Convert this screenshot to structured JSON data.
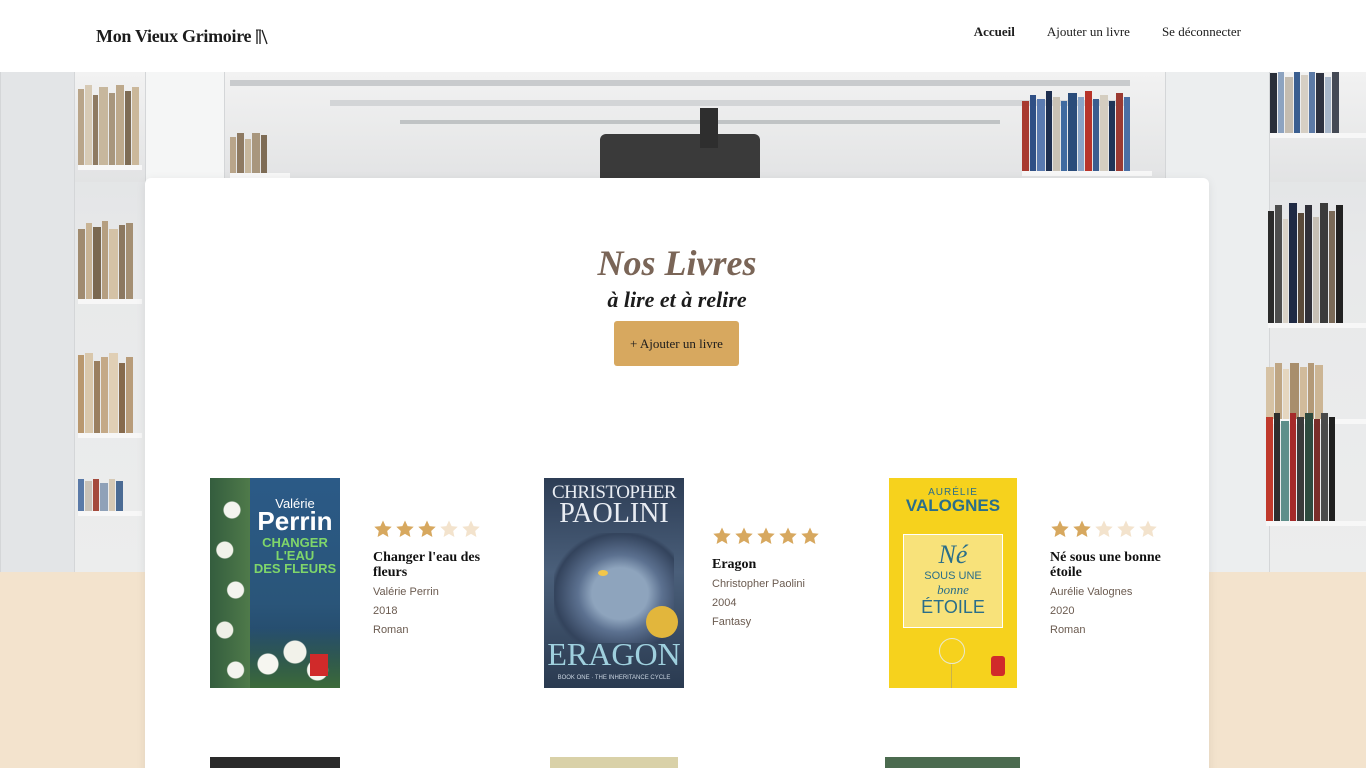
{
  "header": {
    "logo": "Mon Vieux Grimoire",
    "nav": [
      {
        "label": "Accueil",
        "active": true
      },
      {
        "label": "Ajouter un livre",
        "active": false
      },
      {
        "label": "Se déconnecter",
        "active": false
      }
    ]
  },
  "hero": {
    "title": "Nos Livres",
    "subtitle": "à lire et à relire",
    "add_button": "+ Ajouter un livre"
  },
  "colors": {
    "accent": "#d7a85f",
    "star_filled": "#d7a85f",
    "star_empty": "#f3e3cd",
    "page_background": "#f3e3cd"
  },
  "books": [
    {
      "title": "Changer l'eau des fleurs",
      "author": "Valérie Perrin",
      "year": "2018",
      "genre": "Roman",
      "rating": 3,
      "cover": {
        "author_line1": "Valérie",
        "author_line2": "Perrin",
        "title_line1": "CHANGER",
        "title_line2": "L'EAU",
        "title_line3": "DES FLEURS"
      }
    },
    {
      "title": "Eragon",
      "author": "Christopher Paolini",
      "year": "2004",
      "genre": "Fantasy",
      "rating": 5,
      "cover": {
        "author_line1": "CHRISTOPHER",
        "author_line2": "PAOLINI",
        "title_line1": "ERAGON",
        "footer": "BOOK ONE · THE INHERITANCE CYCLE"
      }
    },
    {
      "title": "Né sous une bonne étoile",
      "author": "Aurélie Valognes",
      "year": "2020",
      "genre": "Roman",
      "rating": 2,
      "cover": {
        "author_line1": "AURÉLIE",
        "author_line2": "VALOGNES",
        "title_line1": "Né",
        "title_line2": "SOUS UNE",
        "title_line3": "bonne",
        "title_line4": "ÉTOILE"
      }
    }
  ]
}
